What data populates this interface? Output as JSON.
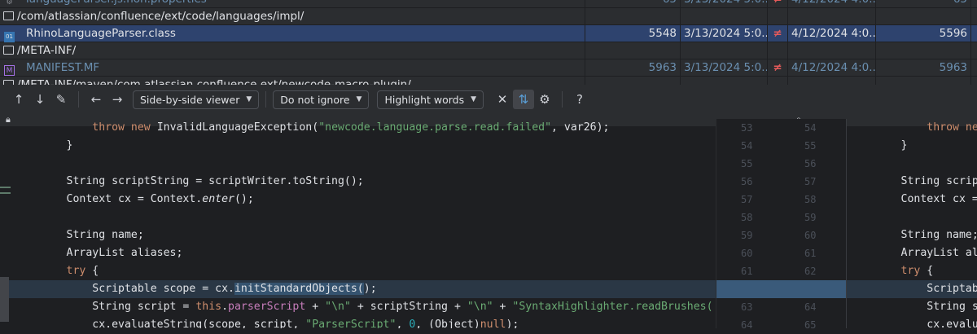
{
  "table": {
    "rows": [
      {
        "type": "file",
        "name": "languageParser.js.non.properties",
        "size_left": "65",
        "date_left": "3/13/2024 5:0...",
        "neq": "≠",
        "date_right": "4/12/2024 4:0...",
        "size_right": "65",
        "muted": true
      },
      {
        "type": "folder",
        "name": "/com/atlassian/confluence/ext/code/languages/impl/"
      },
      {
        "type": "class",
        "name": "RhinoLanguageParser.class",
        "size_left": "5548",
        "date_left": "3/13/2024 5:0...",
        "neq": "≠",
        "date_right": "4/12/2024 4:0...",
        "size_right": "5596",
        "selected": true
      },
      {
        "type": "folder",
        "name": "/META-INF/"
      },
      {
        "type": "manifest",
        "name": "MANIFEST.MF",
        "size_left": "5963",
        "date_left": "3/13/2024 5:0...",
        "neq": "≠",
        "date_right": "4/12/2024 4:0...",
        "size_right": "5963",
        "muted": true
      },
      {
        "type": "folder",
        "name": "/META-INF/maven/com.atlassian.confluence.ext/newcode-macro-plugin/"
      }
    ]
  },
  "toolbar": {
    "viewer": "Side-by-side viewer",
    "ignore": "Do not ignore",
    "highlight": "Highlight words",
    "help": "?"
  },
  "colors": {
    "keyword": "#cf8e6d",
    "string": "#6aab73",
    "field": "#c77dbb",
    "number": "#2aacb8",
    "selection": "#2e436e"
  },
  "code": {
    "lines": [
      {
        "l": "53",
        "r": "54",
        "t": [
          [
            "            "
          ],
          [
            "throw new ",
            "kw"
          ],
          [
            "InvalidLanguageException("
          ],
          [
            "\"newcode.language.parse.read.failed\"",
            "str"
          ],
          [
            ", var26);"
          ]
        ]
      },
      {
        "l": "54",
        "r": "55",
        "t": [
          [
            "        }"
          ]
        ]
      },
      {
        "l": "55",
        "r": "56",
        "t": [
          [
            ""
          ]
        ]
      },
      {
        "l": "56",
        "r": "57",
        "t": [
          [
            "        String scriptString = scriptWriter.toString();"
          ]
        ]
      },
      {
        "l": "57",
        "r": "58",
        "t": [
          [
            "        Context cx = Context."
          ],
          [
            "enter",
            "it"
          ],
          [
            "();"
          ]
        ]
      },
      {
        "l": "58",
        "r": "59",
        "t": [
          [
            ""
          ]
        ]
      },
      {
        "l": "59",
        "r": "60",
        "t": [
          [
            "        String name;"
          ]
        ]
      },
      {
        "l": "60",
        "r": "61",
        "t": [
          [
            "        ArrayList aliases;"
          ]
        ]
      },
      {
        "l": "61",
        "r": "62",
        "t": [
          [
            "        "
          ],
          [
            "try",
            "kw"
          ],
          [
            " {"
          ]
        ]
      },
      {
        "l": "",
        "r": "",
        "hl": true,
        "t": [
          [
            "            Scriptable scope = cx."
          ],
          [
            "initStandardObjects(",
            "word"
          ],
          [
            ");"
          ]
        ]
      },
      {
        "l": "63",
        "r": "64",
        "t": [
          [
            "            String script = "
          ],
          [
            "this",
            "kw"
          ],
          [
            "."
          ],
          [
            "parserScript",
            "fld"
          ],
          [
            " + "
          ],
          [
            "\"\\n\"",
            "str"
          ],
          [
            " + scriptString + "
          ],
          [
            "\"\\n\"",
            "str"
          ],
          [
            " + "
          ],
          [
            "\"SyntaxHighlighter.readBrushes(",
            "str"
          ]
        ]
      },
      {
        "l": "64",
        "r": "65",
        "t": [
          [
            "            cx.evaluateString(scope, script, "
          ],
          [
            "\"ParserScript\"",
            "str"
          ],
          [
            ", "
          ],
          [
            "0",
            "num"
          ],
          [
            ", (Object)"
          ],
          [
            "null",
            "kw"
          ],
          [
            ");"
          ]
        ]
      }
    ]
  }
}
